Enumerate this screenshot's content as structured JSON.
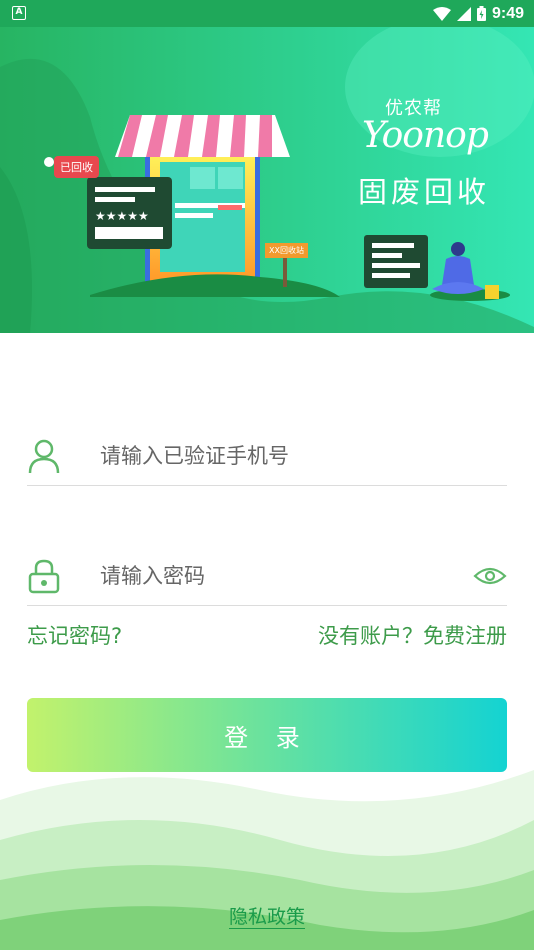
{
  "status_bar": {
    "notification_icon": "A",
    "time": "9:49"
  },
  "hero": {
    "brand_cn": "优农帮",
    "brand_en": "Yoonop",
    "slogan": "固废回收",
    "recycled_tag": "已回收",
    "station_tag": "XX回收站",
    "colors": {
      "primary": "#1fa85a",
      "accent": "#2fd99a"
    }
  },
  "login": {
    "phone_placeholder": "请输入已验证手机号",
    "password_placeholder": "请输入密码",
    "forgot_password": "忘记密码?",
    "register": "没有账户？免费注册",
    "login_button": "登 录",
    "privacy_policy": "隐私政策"
  }
}
